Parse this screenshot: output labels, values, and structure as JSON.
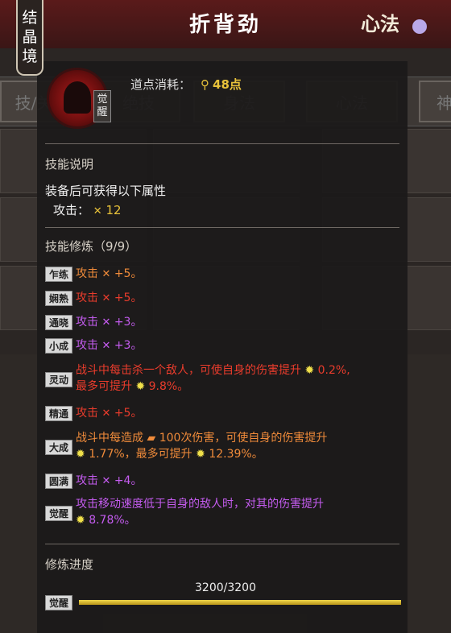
{
  "header": {
    "realm": [
      "结",
      "晶",
      "境"
    ],
    "title": "折背劲",
    "school": "心法"
  },
  "background": {
    "tabs": [
      "技/关",
      "绝技",
      "身法",
      "心法",
      "神"
    ]
  },
  "skill": {
    "icon": "warrior-silhouette-icon",
    "awaken_badge": [
      "觉",
      "醒"
    ],
    "cost_label": "道点消耗：",
    "cost_value": "48点"
  },
  "description": {
    "header": "技能说明",
    "equip_text": "装备后可获得以下属性",
    "attack_label": "攻击：",
    "attack_value": "12"
  },
  "cultivation": {
    "header": "技能修炼（9/9）",
    "rows": [
      {
        "badge": "乍练",
        "color": "#f08b3a",
        "pre": "攻击",
        "post": "+5。"
      },
      {
        "badge": "娴熟",
        "color": "#ea3c2c",
        "pre": "攻击",
        "post": "+5。"
      },
      {
        "badge": "通晓",
        "color": "#c55cf0",
        "pre": "攻击",
        "post": "+3。"
      },
      {
        "badge": "小成",
        "color": "#c55cf0",
        "pre": "攻击",
        "post": "+3。"
      },
      {
        "badge": "灵动",
        "color": "#ea3c2c",
        "line1": "战斗中每击杀一个敌人，可使自身的伤害提升",
        "line1_val": "0.2%,",
        "line2_pre": "最多可提升",
        "line2_val": "9.8%。"
      },
      {
        "badge": "精通",
        "color": "#ea3c2c",
        "pre": "攻击",
        "post": "+5。"
      },
      {
        "badge": "大成",
        "color": "#f08b3a",
        "line1_pre": "战斗中每造成",
        "line1_mid": "100次伤害，可使自身的伤害提升",
        "line2_val": "1.77%，最多可提升",
        "line2_end": "12.39%。"
      },
      {
        "badge": "圆满",
        "color": "#c55cf0",
        "pre": "攻击",
        "post": "+4。"
      },
      {
        "badge": "觉醒",
        "color": "#c55cf0",
        "line1": "攻击移动速度低于自身的敌人时，对其的伤害提升",
        "line2_val": "8.78%。"
      }
    ]
  },
  "progress": {
    "header": "修炼进度",
    "value": "3200/3200",
    "badge": "觉醒",
    "fraction": 1.0
  },
  "colors": {
    "accent_gold": "#e8c23a",
    "orange": "#f08b3a",
    "red": "#ea3c2c",
    "purple": "#c55cf0"
  }
}
